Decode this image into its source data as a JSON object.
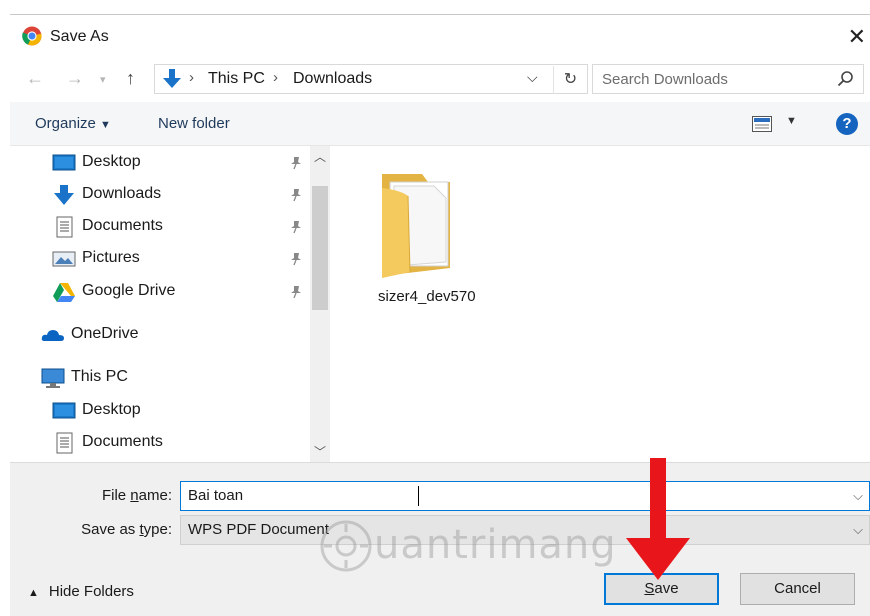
{
  "window": {
    "title": "Save As",
    "close_glyph": "✕"
  },
  "address": {
    "crumbs": [
      "This PC",
      "Downloads"
    ],
    "search_placeholder": "Search Downloads"
  },
  "toolbar": {
    "organize": "Organize",
    "new_folder": "New folder",
    "help": "?"
  },
  "nav": {
    "items": [
      {
        "label": "Desktop",
        "icon": "desktop-icon",
        "pinned": true
      },
      {
        "label": "Downloads",
        "icon": "downloads-icon",
        "pinned": true
      },
      {
        "label": "Documents",
        "icon": "documents-icon",
        "pinned": true
      },
      {
        "label": "Pictures",
        "icon": "pictures-icon",
        "pinned": true
      },
      {
        "label": "Google Drive",
        "icon": "google-drive-icon",
        "pinned": true
      },
      {
        "label": "OneDrive",
        "icon": "onedrive-icon",
        "pinned": false
      },
      {
        "label": "This PC",
        "icon": "this-pc-icon",
        "pinned": false
      },
      {
        "label": "Desktop",
        "icon": "desktop-icon",
        "pinned": false
      },
      {
        "label": "Documents",
        "icon": "documents-icon",
        "pinned": false
      }
    ]
  },
  "content": {
    "folder_name": "sizer4_dev570"
  },
  "form": {
    "file_name_label_pre": "File ",
    "file_name_label_key": "n",
    "file_name_label_post": "ame:",
    "file_name_value": "Bai toan",
    "save_type_label_pre": "Save as ",
    "save_type_label_key": "t",
    "save_type_label_post": "ype:",
    "save_type_value": "WPS PDF Document"
  },
  "footer": {
    "hide_folders": "Hide Folders",
    "save_key": "S",
    "save_rest": "ave",
    "cancel": "Cancel"
  },
  "watermark": {
    "text": "uantrimang"
  },
  "colors": {
    "accent": "#0078d7",
    "arrow": "#e8161b",
    "folder": "#f4c95d"
  }
}
